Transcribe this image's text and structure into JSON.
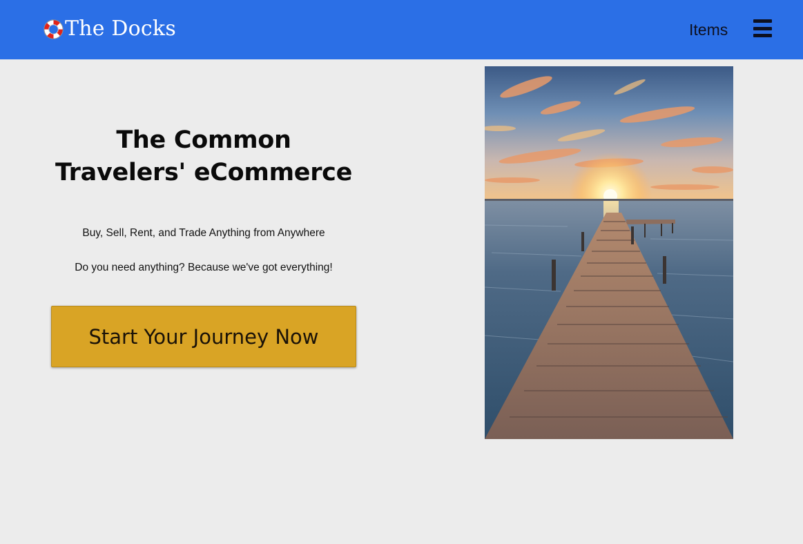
{
  "navbar": {
    "brand_icon": "lifebuoy-icon",
    "brand_text": "The Docks",
    "items_link": "Items",
    "menu_icon": "hamburger-menu-icon",
    "background_color": "#2b6fe6"
  },
  "hero": {
    "title": "The Common Travelers' eCommerce",
    "tagline_1": "Buy, Sell, Rent, and Trade Anything from Anywhere",
    "tagline_2": "Do you need anything? Because we've got everything!",
    "cta_label": "Start Your Journey Now",
    "cta_color": "#d9a425",
    "image": "sunset-dock-photo"
  },
  "page": {
    "background_color": "#ececec"
  }
}
